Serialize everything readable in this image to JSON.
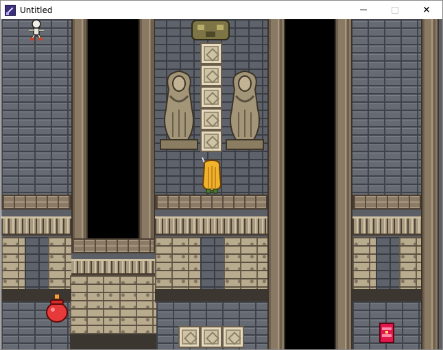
{
  "window": {
    "title": "Untitled",
    "controls": {
      "minimize": "minimize",
      "maximize": "maximize",
      "close": "✕"
    }
  },
  "icons": {
    "app": "app-icon",
    "hero": "hero-sprite",
    "skeleton": "skeleton-sprite",
    "statue": "statue-sprite",
    "treasure": "treasure-chest-icon",
    "pot": "pot-icon",
    "golem": "golem-sprite"
  },
  "colors": {
    "wall": "#666a72",
    "stone": "#b9ab8e",
    "pit": "#000000",
    "hero_hair": "#f0b32c",
    "chest": "#e2174c",
    "pot": "#e63a3a"
  }
}
